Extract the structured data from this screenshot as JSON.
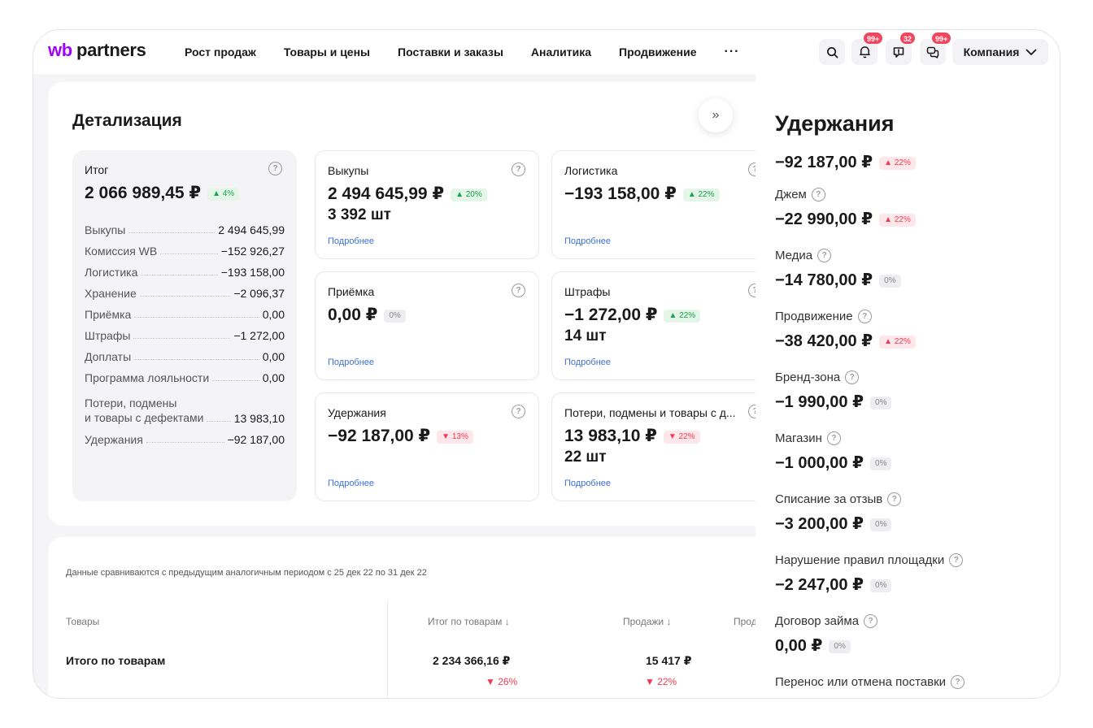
{
  "brand": {
    "wb": "wb",
    "partners": "partners"
  },
  "nav": {
    "items": [
      "Рост продаж",
      "Товары и цены",
      "Поставки и заказы",
      "Аналитика",
      "Продвижение"
    ],
    "more": "···"
  },
  "header_icons": {
    "notifications_badge": "99+",
    "messages_badge": "32",
    "chat_badge": "99+"
  },
  "company": {
    "label": "Компания"
  },
  "detail": {
    "title": "Детализация",
    "collapse_icon": "»",
    "summary": {
      "label": "Итог",
      "total": "2 066 989,45 ₽",
      "change": "▲ 4%",
      "rows": [
        {
          "label": "Выкупы",
          "value": "2 494 645,99"
        },
        {
          "label": "Комиссия WB",
          "value": "−152 926,27"
        },
        {
          "label": "Логистика",
          "value": "−193 158,00"
        },
        {
          "label": "Хранение",
          "value": "−2 096,37"
        },
        {
          "label": "Приёмка",
          "value": "0,00"
        },
        {
          "label": "Штрафы",
          "value": "−1 272,00"
        },
        {
          "label": "Доплаты",
          "value": "0,00"
        },
        {
          "label": "Программа лояльности",
          "value": "0,00"
        },
        {
          "label_line1": "Потери, подмены",
          "label_line2": "и товары с дефектами",
          "value": "13 983,10"
        },
        {
          "label": "Удержания",
          "value": "−92 187,00"
        }
      ]
    },
    "cards": [
      {
        "label": "Выкупы",
        "value": "2 494 645,99 ₽",
        "change": "▲ 20%",
        "sub": "3 392 шт",
        "link": "Подробнее"
      },
      {
        "label": "Логистика",
        "value": "−193 158,00 ₽",
        "change": "▲ 22%",
        "sub": "",
        "link": "Подробнее"
      },
      {
        "label": "Приёмка",
        "value": "0,00 ₽",
        "change": "0%",
        "sub": "",
        "link": "Подробнее"
      },
      {
        "label": "Штрафы",
        "value": "−1 272,00 ₽",
        "change": "▲ 22%",
        "sub": "14 шт",
        "link": "Подробнее"
      },
      {
        "label": "Удержания",
        "value": "−92 187,00 ₽",
        "change": "▼ 13%",
        "sub": "",
        "link": "Подробнее"
      },
      {
        "label": "Потери, подмены и товары с д...",
        "value": "13 983,10 ₽",
        "change": "▼ 22%",
        "sub": "22 шт",
        "link": "Подробнее"
      }
    ]
  },
  "table": {
    "compare_note": "Данные сравниваются с предыдущим аналогичным периодом с 25 дек 22 по 31 дек 22",
    "headers": {
      "products": "Товары",
      "total": "Итог по товарам ↓",
      "sales": "Продажи ↓",
      "cut": "Прод"
    },
    "total_row": {
      "label": "Итого по товарам",
      "total_value": "2 234 366,16 ₽",
      "total_change": "▼ 26%",
      "sales_value": "15 417 ₽",
      "sales_change": "▼ 22%"
    }
  },
  "panel": {
    "title": "Удержания",
    "total": "−92 187,00 ₽",
    "total_change": "▲ 22%",
    "items": [
      {
        "label": "Джем",
        "value": "−22 990,00 ₽",
        "change": "▲ 22%"
      },
      {
        "label": "Медиа",
        "value": "−14 780,00 ₽",
        "change": "0%"
      },
      {
        "label": "Продвижение",
        "value": "−38 420,00 ₽",
        "change": "▲ 22%"
      },
      {
        "label": "Бренд-зона",
        "value": "−1 990,00 ₽",
        "change": "0%"
      },
      {
        "label": "Магазин",
        "value": "−1 000,00 ₽",
        "change": "0%"
      },
      {
        "label": "Списание за отзыв",
        "value": "−3 200,00 ₽",
        "change": "0%"
      },
      {
        "label": "Нарушение правил площадки",
        "value": "−2 247,00 ₽",
        "change": "0%"
      },
      {
        "label": "Договор займа",
        "value": "0,00 ₽",
        "change": "0%"
      },
      {
        "label": "Перенос или отмена поставки",
        "value": "",
        "change": ""
      }
    ]
  },
  "colors": {
    "brand_purple": "#a100ff",
    "up_green": "#18a34a",
    "down_red": "#ef3b52",
    "link_blue": "#3d6fd9",
    "badge_red": "#f0465e"
  }
}
